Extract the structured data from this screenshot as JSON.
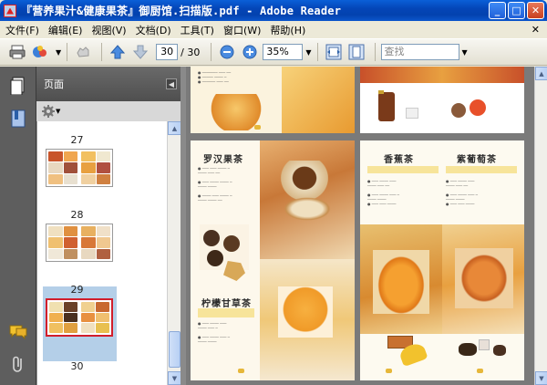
{
  "window": {
    "title": "『营养果汁&健康果茶』御厨馆.扫描版.pdf - Adobe Reader",
    "minimize_label": "_",
    "maximize_label": "□",
    "close_label": "✕"
  },
  "menu": {
    "items": [
      "文件(F)",
      "编辑(E)",
      "视图(V)",
      "文档(D)",
      "工具(T)",
      "窗口(W)",
      "帮助(H)"
    ],
    "close_label": "✕"
  },
  "toolbar": {
    "current_page": "30",
    "page_total": "/ 30",
    "zoom": "35%",
    "search_placeholder": "查找"
  },
  "panel": {
    "title": "页面",
    "thumbnails": [
      {
        "label": "27"
      },
      {
        "label": "28"
      },
      {
        "label": "29"
      },
      {
        "label": "30"
      }
    ]
  },
  "document": {
    "page_left_title": "罗汉果茶",
    "page_left_title2": "柠檬甘草茶",
    "page_right_title": "香蕉茶",
    "page_right_title2": "紫葡萄茶"
  },
  "colors": {
    "titlebar": "#0446b8",
    "selection_border": "#d21e2b",
    "doc_bg": "#7a7a7a"
  }
}
